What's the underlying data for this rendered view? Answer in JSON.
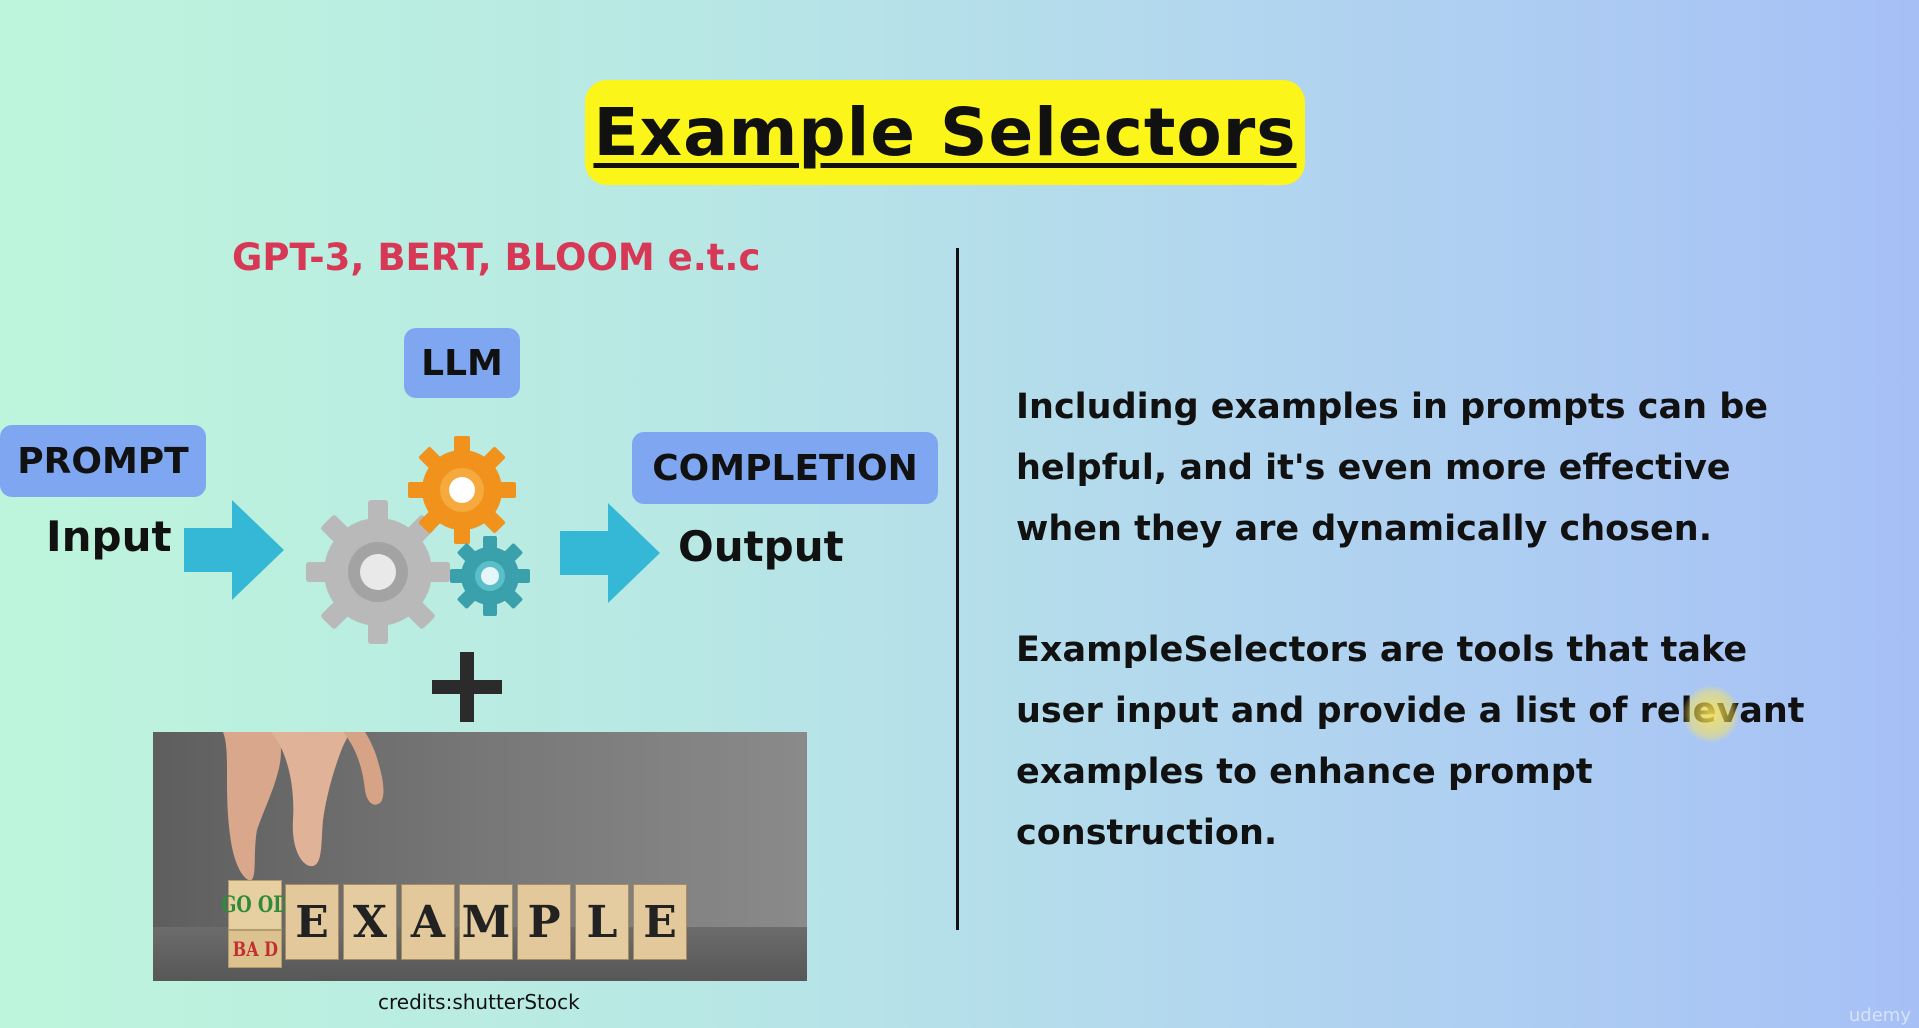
{
  "title": "Example Selectors",
  "left": {
    "models_text": "GPT-3, BERT, BLOOM e.t.c",
    "llm_label": "LLM",
    "prompt_label": "PROMPT",
    "input_label": "Input",
    "completion_label": "COMPLETION",
    "output_label": "Output",
    "plus_symbol": "+",
    "photo": {
      "dice_top": "GO OD",
      "dice_bottom": "BA D",
      "word_letters": [
        "E",
        "X",
        "A",
        "M",
        "P",
        "L",
        "E"
      ]
    },
    "credits": "credits:shutterStock"
  },
  "right": {
    "paragraph_1": "Including examples in prompts can be helpful, and it's even more effective when they are dynamically chosen.",
    "paragraph_2": "ExampleSelectors are tools that take user input and provide a list of relevant examples to enhance prompt construction."
  },
  "watermark": "udemy",
  "colors": {
    "title_bg": "#fbf51a",
    "models_text": "#d63855",
    "tag_bg": "#7fa7f1",
    "arrow": "#34b8d6",
    "gear_orange": "#f0921b",
    "gear_grey": "#b9b9b9",
    "gear_teal": "#3aa0ab"
  }
}
